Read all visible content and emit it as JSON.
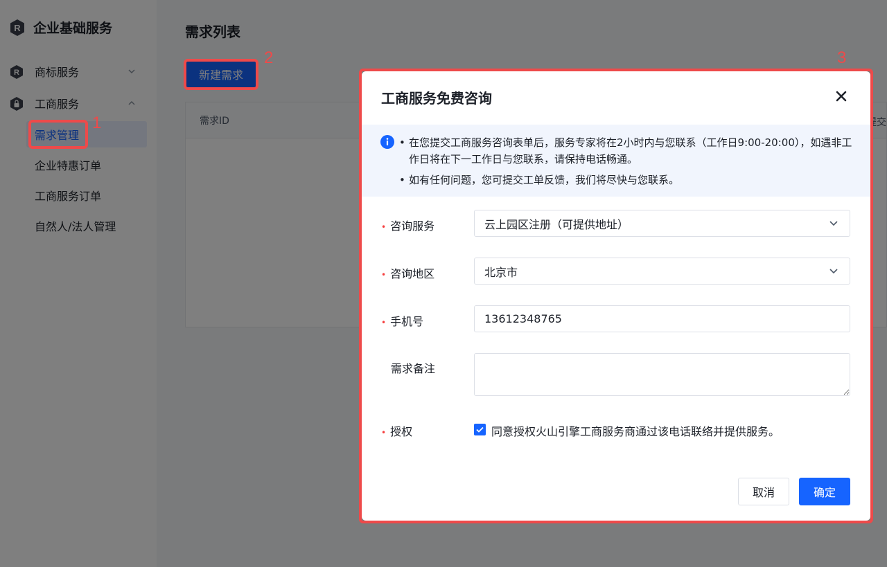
{
  "app": {
    "title": "企业基础服务",
    "logo_icon": "r-logo-icon"
  },
  "sidebar": {
    "groups": [
      {
        "label": "商标服务",
        "icon": "r-logo-icon",
        "expanded": false
      },
      {
        "label": "工商服务",
        "icon": "lock-icon",
        "expanded": true
      }
    ],
    "sub_items": [
      {
        "label": "需求管理",
        "active": true
      },
      {
        "label": "企业特惠订单"
      },
      {
        "label": "工商服务订单"
      },
      {
        "label": "自然人/法人管理"
      }
    ]
  },
  "main": {
    "title": "需求列表",
    "new_button": "新建需求",
    "table": {
      "col_id": "需求ID",
      "col_right": "提交"
    }
  },
  "annotations": [
    "1",
    "2",
    "3"
  ],
  "modal": {
    "title": "工商服务免费咨询",
    "notice": {
      "line1": "在您提交工商服务咨询表单后，服务专家将在2小时内与您联系（工作日9:00-20:00），如遇非工作日将在下一工作日与您联系，请保持电话畅通。",
      "line2": "如有任何问题，您可提交工单反馈，我们将尽快与您联系。"
    },
    "form": {
      "service_label": "咨询服务",
      "service_value": "云上园区注册（可提供地址）",
      "region_label": "咨询地区",
      "region_value": "北京市",
      "phone_label": "手机号",
      "phone_value": "13612348765",
      "remark_label": "需求备注",
      "remark_value": "",
      "auth_label": "授权",
      "auth_text": "同意授权火山引擎工商服务商通过该电话联络并提供服务。",
      "auth_checked": true,
      "required_mark": "•"
    },
    "cancel_label": "取消",
    "ok_label": "确定"
  },
  "colors": {
    "primary": "#1664ff",
    "annotation": "#ee4a4a",
    "required": "#f53f3f"
  }
}
